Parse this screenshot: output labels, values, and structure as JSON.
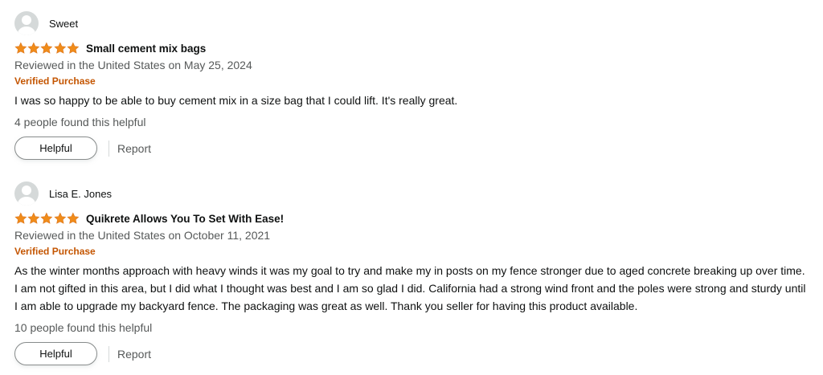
{
  "colors": {
    "star": "#f08c1a",
    "verified": "#c45500",
    "muted_text": "#565959",
    "avatar_bg": "#d5d9d9"
  },
  "reviews": [
    {
      "author": "Sweet",
      "avatar_icon": "default-user-icon",
      "rating": 5,
      "title": "Small cement mix bags",
      "date": "Reviewed in the United States on May 25, 2024",
      "verified": "Verified Purchase",
      "text": "I was so happy to be able to buy cement mix in a size bag that I could lift. It's really great.",
      "helpful_count": "4 people found this helpful",
      "helpful_label": "Helpful",
      "report_label": "Report"
    },
    {
      "author": "Lisa E. Jones",
      "avatar_icon": "default-user-icon",
      "rating": 5,
      "title": "Quikrete Allows You To Set With Ease!",
      "date": "Reviewed in the United States on October 11, 2021",
      "verified": "Verified Purchase",
      "text": "As the winter months approach with heavy winds it was my goal to try and make my in posts on my fence stronger due to aged concrete breaking up over time. I am not gifted in this area, but I did what I thought was best and I am so glad I did. California had a strong wind front and the poles were strong and sturdy until I am able to upgrade my backyard fence. The packaging was great as well. Thank you seller for having this product available.",
      "helpful_count": "10 people found this helpful",
      "helpful_label": "Helpful",
      "report_label": "Report"
    }
  ]
}
